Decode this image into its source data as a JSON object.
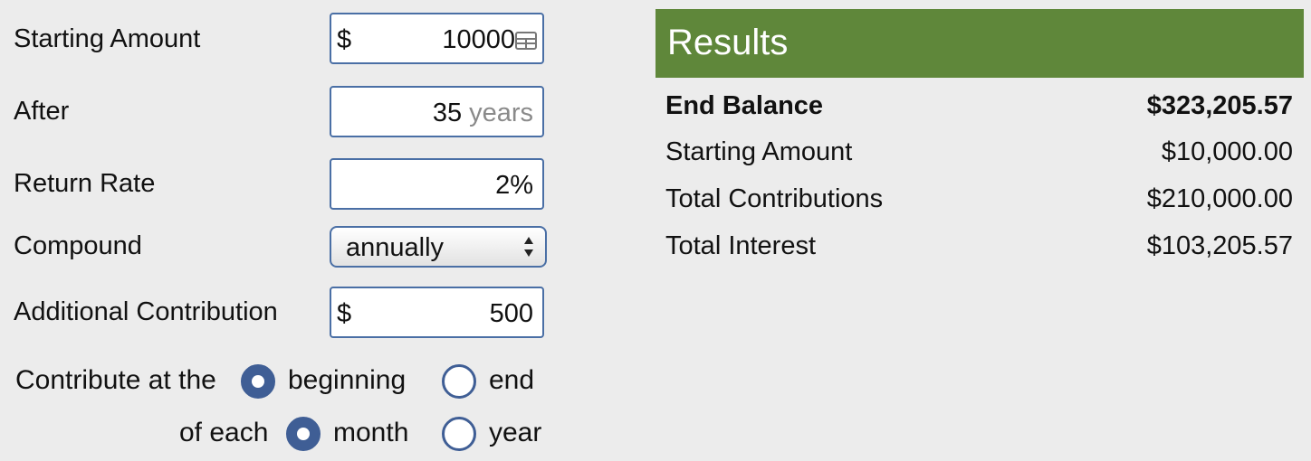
{
  "form": {
    "starting_amount": {
      "label": "Starting Amount",
      "currency": "$",
      "value": "10000"
    },
    "after": {
      "label": "After",
      "value": "35",
      "unit": "years"
    },
    "return_rate": {
      "label": "Return Rate",
      "value": "2%"
    },
    "compound": {
      "label": "Compound",
      "selected": "annually"
    },
    "additional_contribution": {
      "label": "Additional Contribution",
      "currency": "$",
      "value": "500"
    },
    "contribute_at": {
      "label": "Contribute at the",
      "options": [
        {
          "label": "beginning",
          "selected": true
        },
        {
          "label": "end",
          "selected": false
        }
      ]
    },
    "of_each": {
      "label": "of each",
      "options": [
        {
          "label": "month",
          "selected": true
        },
        {
          "label": "year",
          "selected": false
        }
      ]
    }
  },
  "results": {
    "title": "Results",
    "rows": [
      {
        "label": "End Balance",
        "value": "$323,205.57",
        "bold": true
      },
      {
        "label": "Starting Amount",
        "value": "$10,000.00",
        "bold": false
      },
      {
        "label": "Total Contributions",
        "value": "$210,000.00",
        "bold": false
      },
      {
        "label": "Total Interest",
        "value": "$103,205.57",
        "bold": false
      }
    ]
  },
  "colors": {
    "results_header_bg": "#5f873a",
    "field_border": "#4a6fa5",
    "radio_accent": "#3f5e95",
    "page_bg": "#ececec"
  },
  "icons": [
    "calculator-icon",
    "select-arrows-icon"
  ]
}
